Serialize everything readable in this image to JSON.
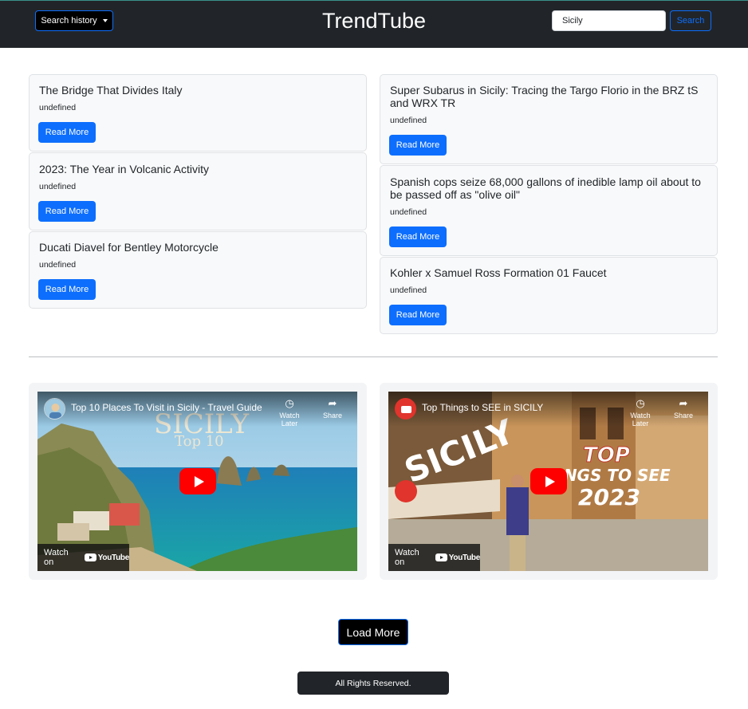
{
  "navbar": {
    "history_label": "Search history",
    "brand": "TrendTube",
    "search_value": "Sicily",
    "search_button": "Search"
  },
  "articles_left": [
    {
      "title": "The Bridge That Divides Italy",
      "subtitle": "undefined",
      "button": "Read More"
    },
    {
      "title": "2023: The Year in Volcanic Activity",
      "subtitle": "undefined",
      "button": "Read More"
    },
    {
      "title": "Ducati Diavel for Bentley Motorcycle",
      "subtitle": "undefined",
      "button": "Read More"
    }
  ],
  "articles_right": [
    {
      "title": "Super Subarus in Sicily: Tracing the Targo Florio in the BRZ tS and WRX TR",
      "subtitle": "undefined",
      "button": "Read More"
    },
    {
      "title": "Spanish cops seize 68,000 gallons of inedible lamp oil about to be passed off as \"olive oil\"",
      "subtitle": "undefined",
      "button": "Read More"
    },
    {
      "title": "Kohler x Samuel Ross Formation 01 Faucet",
      "subtitle": "undefined",
      "button": "Read More"
    }
  ],
  "videos": [
    {
      "title": "Top 10 Places To Visit in Sicily - Travel Guide",
      "overlay_line1": "SICILY",
      "overlay_line2": "Top 10",
      "watch_later": "Watch Later",
      "share": "Share",
      "watch_on": "Watch on",
      "youtube": "YouTube"
    },
    {
      "title": "Top Things to SEE in SICILY",
      "overlay_word": "SICILY",
      "overlay_top": "TOP",
      "overlay_mid": "THINGS TO SEE",
      "overlay_year": "2023",
      "watch_later": "Watch Later",
      "share": "Share",
      "watch_on": "Watch on",
      "youtube": "YouTube"
    }
  ],
  "load_more": "Load More",
  "footer": "All Rights Reserved.",
  "colors": {
    "primary": "#0d6efd",
    "navbar": "#212529",
    "youtube_red": "#ff0000"
  }
}
